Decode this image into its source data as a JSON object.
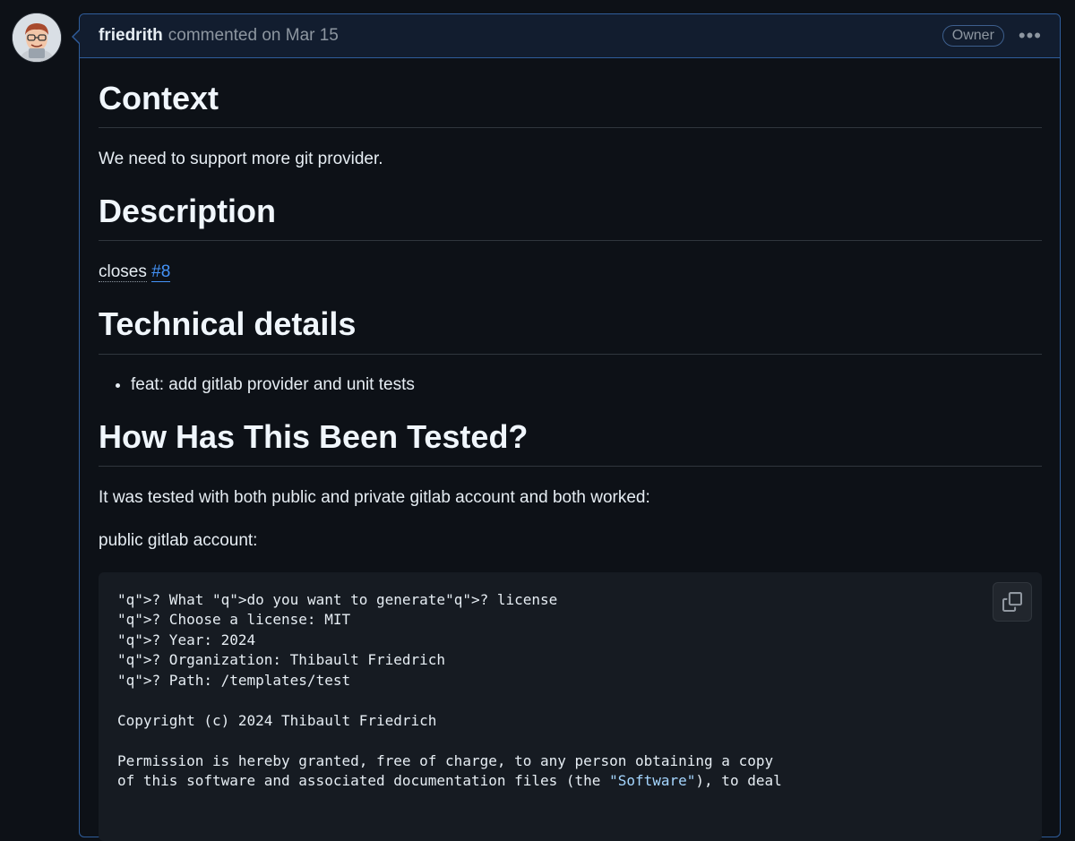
{
  "comment": {
    "author": "friedrith",
    "meta": "commented on Mar 15",
    "badge": "Owner",
    "more_label": "•••"
  },
  "content": {
    "headings": [
      "Context",
      "Description",
      "Technical details",
      "How Has This Been Tested?"
    ],
    "context_text": "We need to support more git provider.",
    "closes_word": "closes",
    "issue_ref": "#8",
    "bullets": [
      "feat: add gitlab provider and unit tests"
    ],
    "tested_text": "It was tested with both public and private gitlab account and both worked:",
    "public_label": "public gitlab account:"
  },
  "code": {
    "lines": [
      "? What do you want to generate? license",
      "? Choose a license: MIT",
      "? Year: 2024",
      "? Organization: Thibault Friedrich",
      "? Path: /templates/test",
      "",
      "Copyright (c) 2024 Thibault Friedrich",
      "",
      "Permission is hereby granted, free of charge, to any person obtaining a copy",
      "of this software and associated documentation files (the \"Software\"), to deal"
    ]
  },
  "icons": {
    "copy": "copy-icon",
    "avatar": "avatar-image",
    "more": "kebab-horizontal-icon"
  },
  "colors": {
    "background": "#0d1117",
    "header_bg": "#121d2f",
    "border_accent": "#2f5d9b",
    "link": "#4493f8",
    "code_keyword": "#ff7b72",
    "code_string": "#a5d6ff"
  }
}
